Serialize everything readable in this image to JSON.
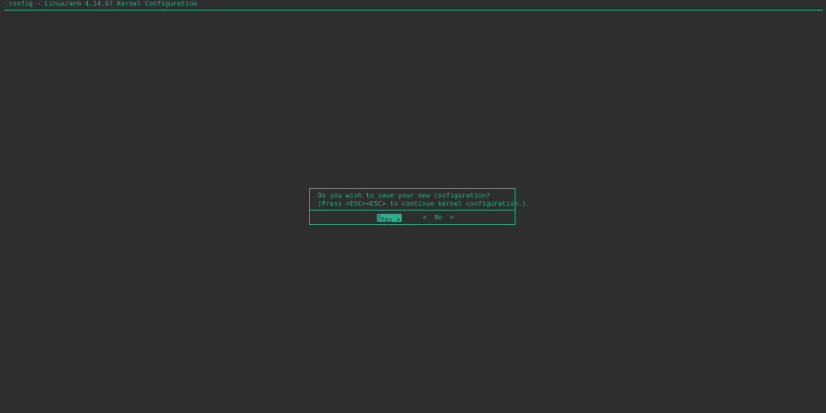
{
  "window": {
    "title": ".config - Linux/arm 4.14.67 Kernel Configuration"
  },
  "dialog": {
    "line1": "Do you wish to save your new configuration?",
    "line2": "(Press <ESC><ESC> to continue kernel configuration.)",
    "buttons": {
      "yes": {
        "left": "<",
        "label": "Yes",
        "right": ">",
        "selected": true
      },
      "no": {
        "left": "<",
        "label": "No",
        "right": ">",
        "selected": false
      }
    }
  },
  "colors": {
    "background": "#2e2e2e",
    "accent": "#27b38f"
  }
}
